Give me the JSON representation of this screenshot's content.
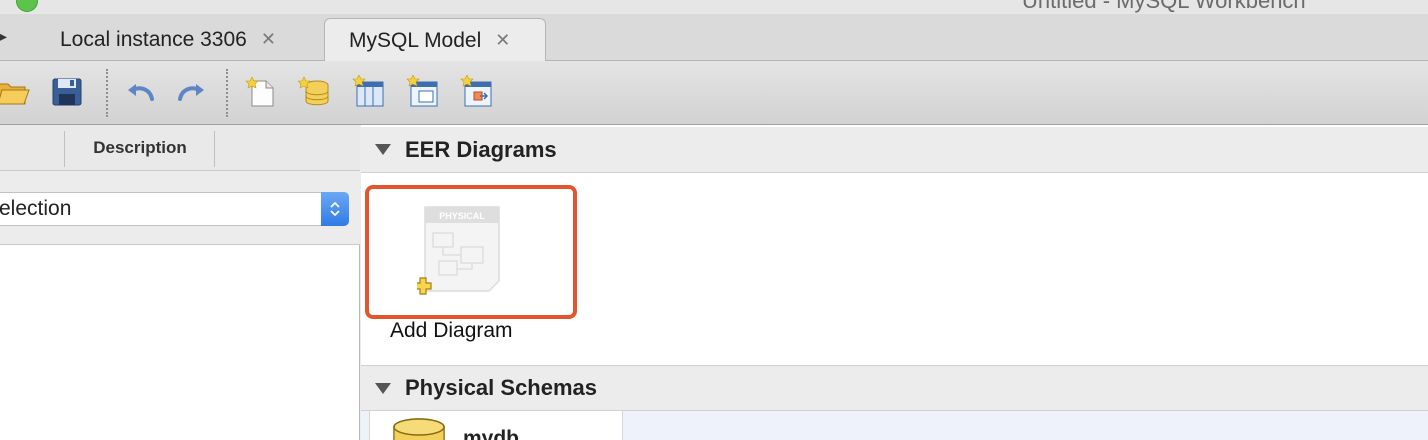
{
  "window": {
    "title": "Untitled - MySQL Workbench"
  },
  "tabs": [
    {
      "label": "Local instance 3306",
      "close": "✕"
    },
    {
      "label": "MySQL Model",
      "close": "✕"
    }
  ],
  "toolbar": {
    "icons": [
      "open-folder-icon",
      "save-icon",
      "undo-icon",
      "redo-icon",
      "new-document-icon",
      "add-schema-icon",
      "add-table-icon",
      "add-view-icon",
      "add-routine-icon"
    ]
  },
  "left_panel": {
    "column_header": "Description",
    "selection_value": "election"
  },
  "eer_section": {
    "title": "EER Diagrams",
    "add_diagram_label": "Add Diagram",
    "diagram_icon_text": "PHYSICAL"
  },
  "physical_section": {
    "title": "Physical Schemas",
    "schema_name": "mydb"
  },
  "colors": {
    "highlight": "#e4552d",
    "select_blue": "#2f7be6"
  }
}
